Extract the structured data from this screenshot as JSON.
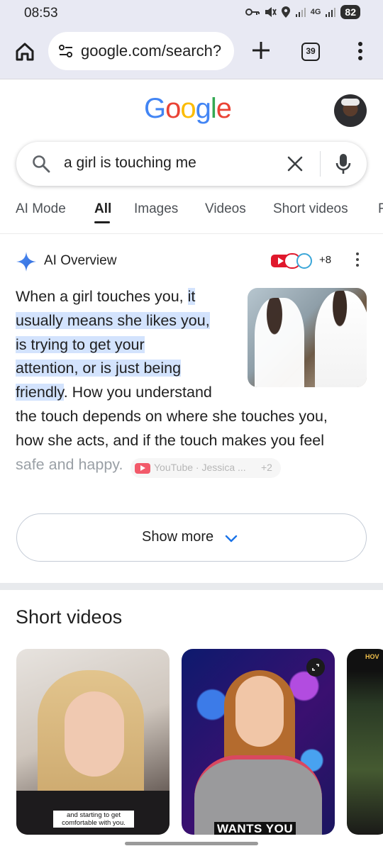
{
  "status_bar": {
    "time": "08:53",
    "network": "4G",
    "battery": "82"
  },
  "browser": {
    "url": "google.com/search?",
    "tab_count": "39"
  },
  "google": {
    "logo_text": "Google"
  },
  "search": {
    "query": "a girl is touching me"
  },
  "tabs": [
    {
      "label": "AI Mode"
    },
    {
      "label": "All"
    },
    {
      "label": "Images"
    },
    {
      "label": "Videos"
    },
    {
      "label": "Short videos"
    },
    {
      "label": "F"
    }
  ],
  "ai_overview": {
    "title": "AI Overview",
    "more_sources": "+8",
    "lines": {
      "l1_a": "When a girl touches you, ",
      "l1_b": "it",
      "l2": "usually means she likes you,",
      "l3": "is trying to get your",
      "l4": "attention, or is just being",
      "l5_a": "friendly",
      "l5_b": ". How you understand",
      "l6": "the touch depends on where she touches you,",
      "l7": "how she acts, and if the touch makes you feel",
      "l8": "safe and happy."
    },
    "source_chip": {
      "text": "YouTube · Jessica ...",
      "plus": "+2"
    },
    "show_more": "Show more"
  },
  "short_videos": {
    "title": "Short videos",
    "items": [
      {
        "caption": "and starting to get comfortable with you."
      },
      {
        "caption": "WANTS YOU"
      },
      {
        "caption": "HOV"
      }
    ]
  },
  "colors": {
    "accent": "#1a73e8",
    "highlight": "#d3e3fd",
    "chrome_bg": "#e8e9f3"
  }
}
